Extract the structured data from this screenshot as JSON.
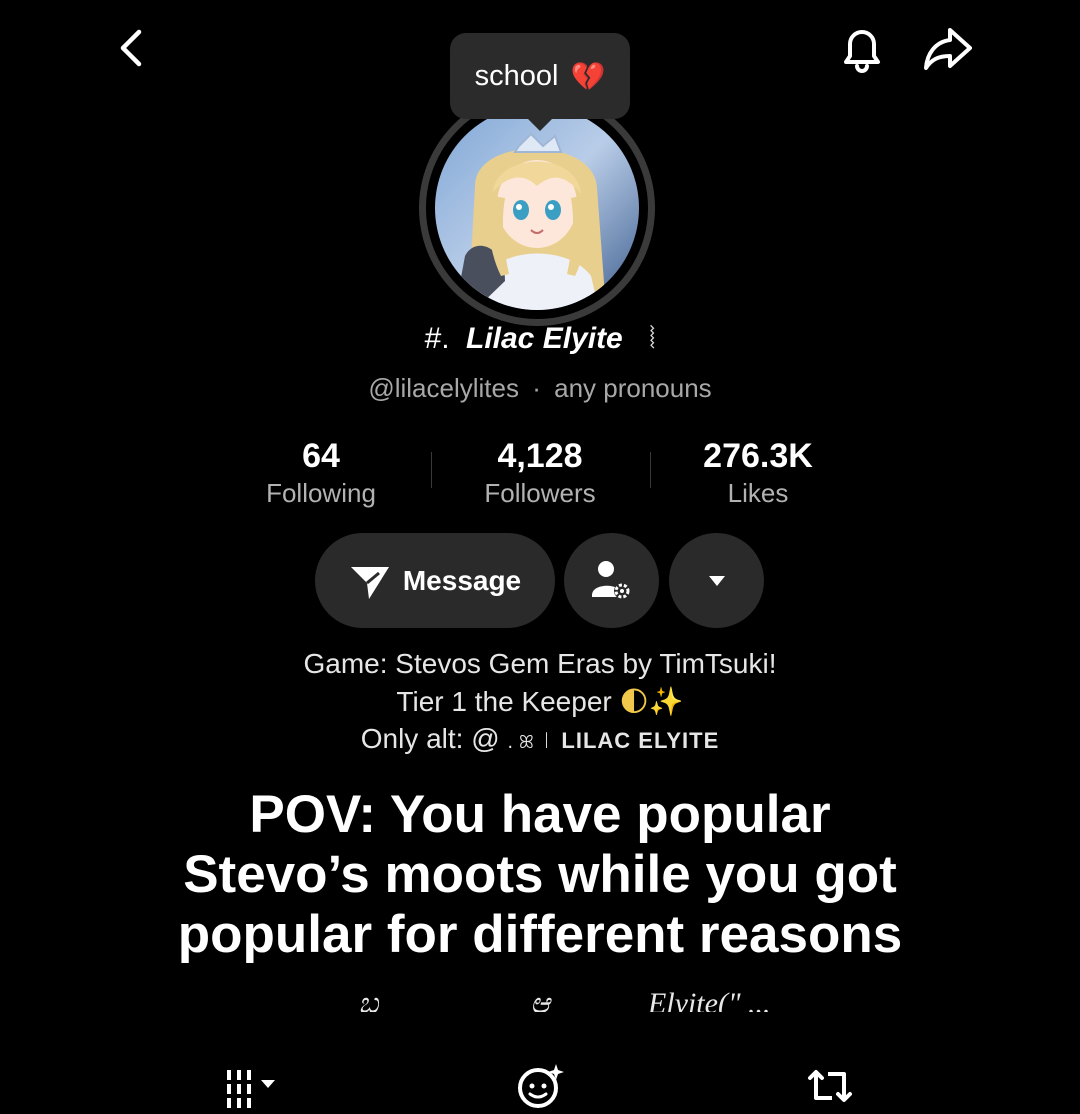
{
  "top_bar": {
    "back_icon": "chevron-left-icon",
    "bell_icon": "bell-icon",
    "share_icon": "share-arrow-icon"
  },
  "status_bubble": {
    "text": "school",
    "emoji": "💔"
  },
  "profile": {
    "name_prefix": "#.",
    "name": "Lilac Elyite",
    "name_suffix": "⦚",
    "handle": "@lilacelylites",
    "separator": "·",
    "pronouns": "any pronouns"
  },
  "stats": [
    {
      "value": "64",
      "label": "Following"
    },
    {
      "value": "4,128",
      "label": "Followers"
    },
    {
      "value": "276.3K",
      "label": "Likes"
    }
  ],
  "actions": {
    "message_label": "Message",
    "message_icon": "send-icon",
    "friend_settings_icon": "person-gear-icon",
    "more_icon": "caret-down-icon"
  },
  "bio": {
    "line1": "Game: Stevos Gem Eras by TimTsuki!",
    "line2": "Tier 1 the Keeper",
    "line2_emoji": "🌓✨",
    "line3_prefix": "Only alt: @",
    "line3_mid": ". ꕤ ꒐",
    "line3_name": "LILAC ELYITE"
  },
  "caption": {
    "line1": "POV: You have popular",
    "line2": "Stevo’s moots while you got",
    "line3": "popular for different reasons"
  },
  "cutoff_text": {
    "left": "ಬ",
    "mid": "ಆ",
    "right": "Elyite(\" ..."
  },
  "bottom_tabs": {
    "videos_icon": "grid-icon",
    "reposts_icon": "sticker-face-icon",
    "repost_icon": "repost-arrows-icon"
  },
  "colors": {
    "background": "#000000",
    "surface": "#2a2a2a",
    "muted_text": "#a8a8a8"
  }
}
